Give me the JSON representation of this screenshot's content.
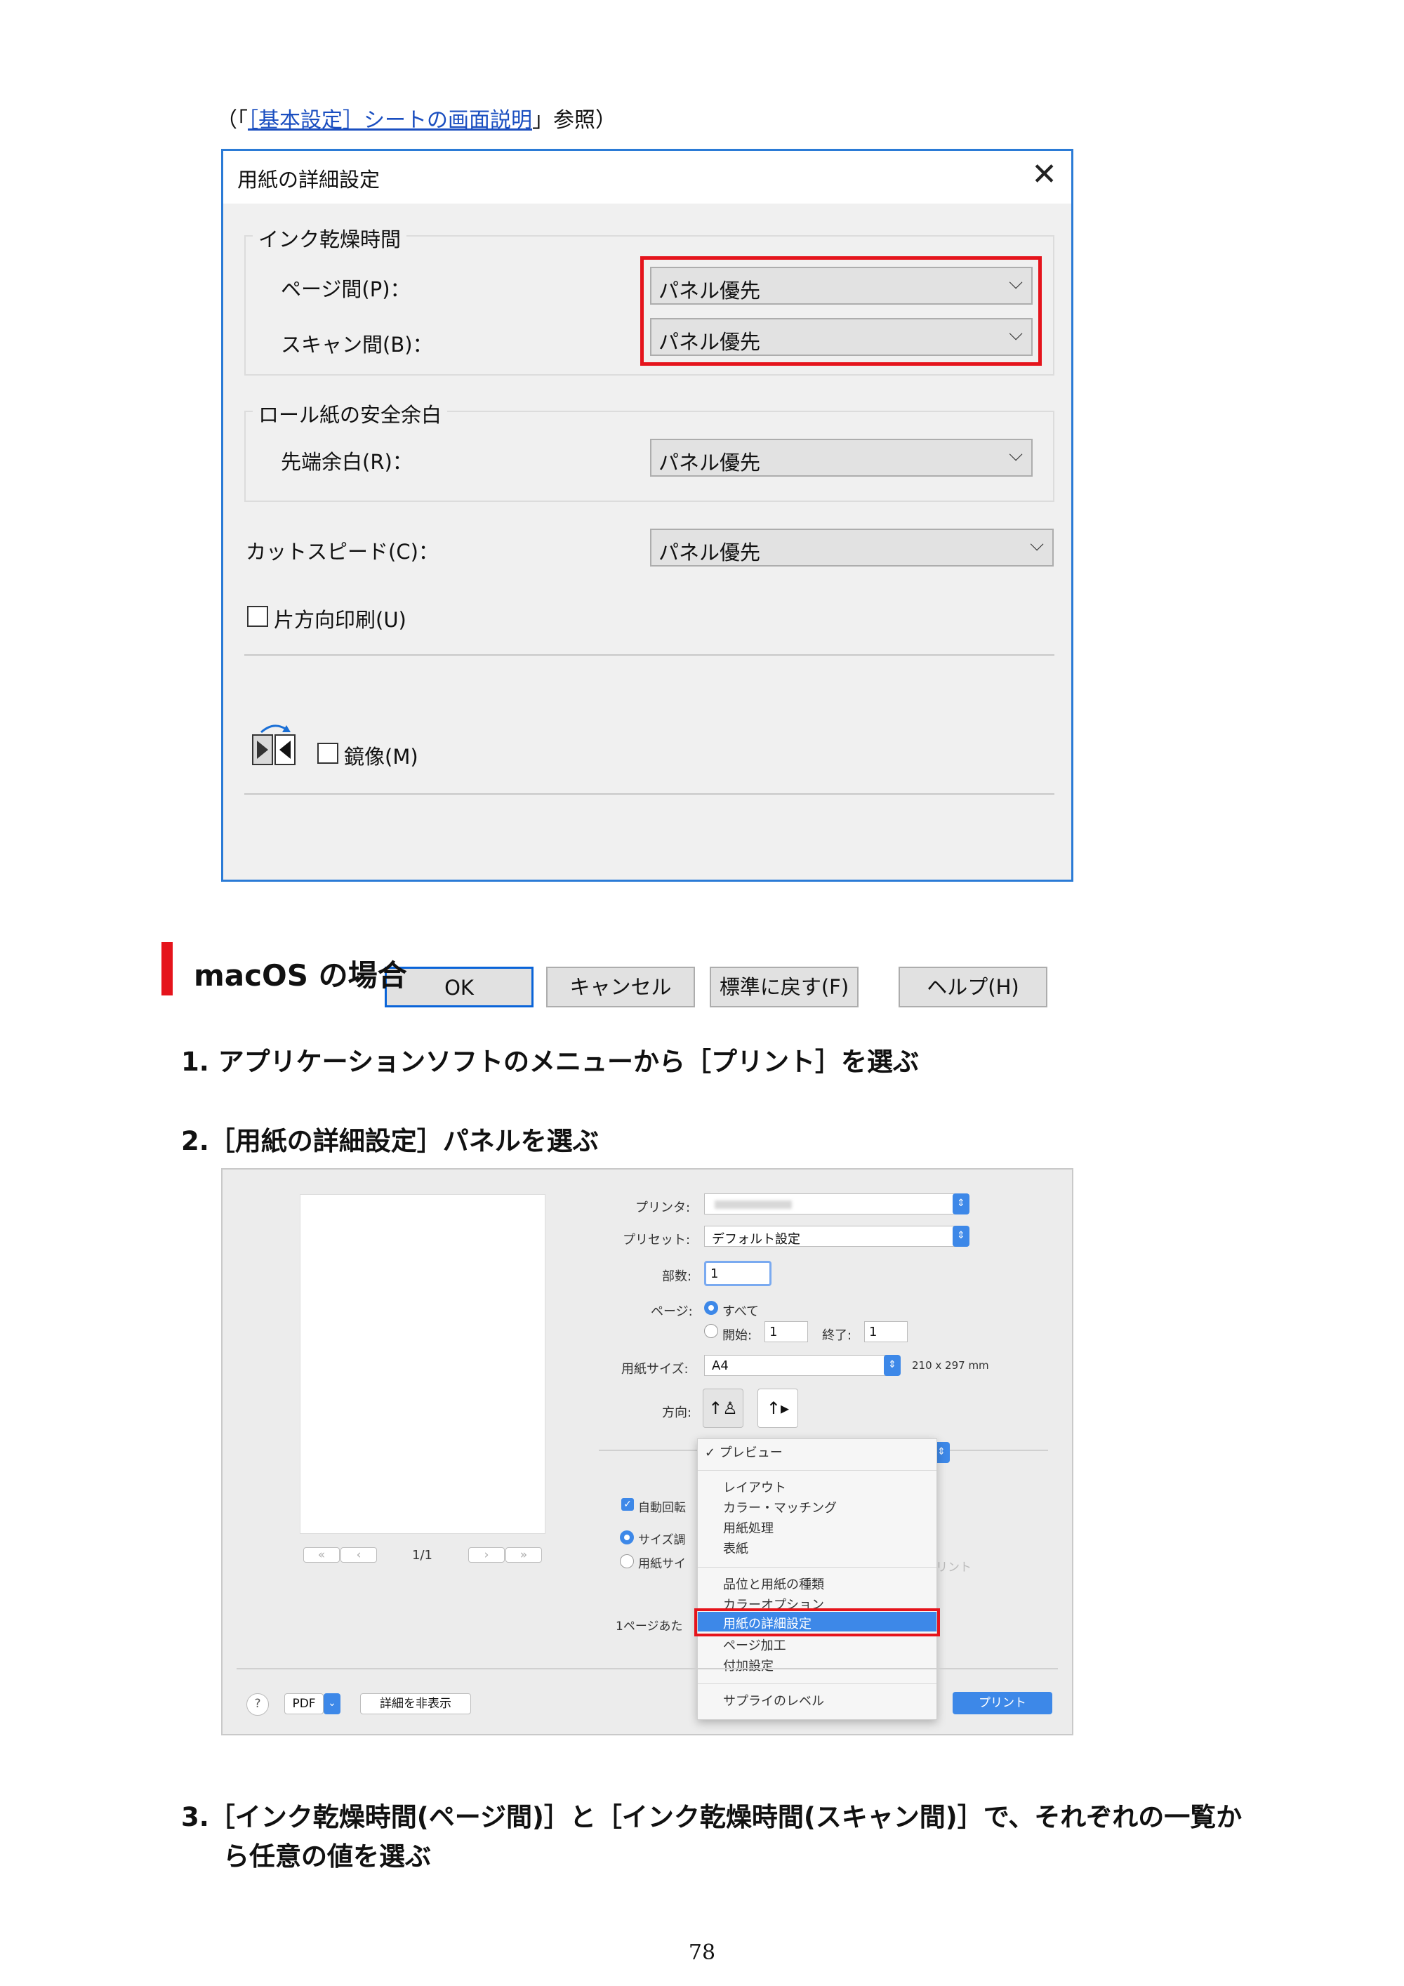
{
  "ref_line": {
    "open": "（「",
    "link_text": "［基本設定］シートの画面説明",
    "close": "」参照）"
  },
  "win_dialog": {
    "title": "用紙の詳細設定",
    "close_glyph": "✕",
    "group_ink": "インク乾燥時間",
    "page_label": "ページ間(P)：",
    "scan_label": "スキャン間(B)：",
    "group_roll": "ロール紙の安全余白",
    "lead_label": "先端余白(R)：",
    "cut_label": "カットスピード(C)：",
    "combo_value": "パネル優先",
    "oneway_label": "片方向印刷(U)",
    "mirror_label": "鏡像(M)",
    "buttons": {
      "ok": "OK",
      "cancel": "キャンセル",
      "defaults": "標準に戻す(F)",
      "help": "ヘルプ(H)"
    }
  },
  "section_heading": "macOS の場合",
  "steps": {
    "s1": "1. アプリケーションソフトのメニューから［プリント］を選ぶ",
    "s2": "2.［用紙の詳細設定］パネルを選ぶ",
    "s3a": "3.［インク乾燥時間(ページ間)］と［インク乾燥時間(スキャン間)］で、それぞれの一覧か",
    "s3b": "ら任意の値を選ぶ"
  },
  "mac_dialog": {
    "printer_label": "プリンタ:",
    "preset_label": "プリセット:",
    "preset_value": "デフォルト設定",
    "copies_label": "部数:",
    "copies_value": "1",
    "pages_label": "ページ:",
    "pages_all": "すべて",
    "pages_from": "開始:",
    "pages_from_value": "1",
    "pages_to": "終了:",
    "pages_to_value": "1",
    "paper_label": "用紙サイズ:",
    "paper_value": "A4",
    "paper_dims": "210 x 297 mm",
    "orient_label": "方向:",
    "page_count": "1/1",
    "auto_rotate": "自動回転",
    "size_adjust": "サイズ調",
    "paper_size_opt": "用紙サイ",
    "per_page": "1ページあた",
    "print_right": "リント",
    "help_glyph": "?",
    "pdf": "PDF",
    "hide_details": "詳細を非表示",
    "print_button": "プリント",
    "menu_items": [
      "✓ プレビュー",
      "レイアウト",
      "カラー・マッチング",
      "用紙処理",
      "表紙",
      "品位と用紙の種類",
      "カラーオプション",
      "用紙の詳細設定",
      "ページ加工",
      "付加設定",
      "サプライのレベル"
    ]
  },
  "page_number": "78"
}
